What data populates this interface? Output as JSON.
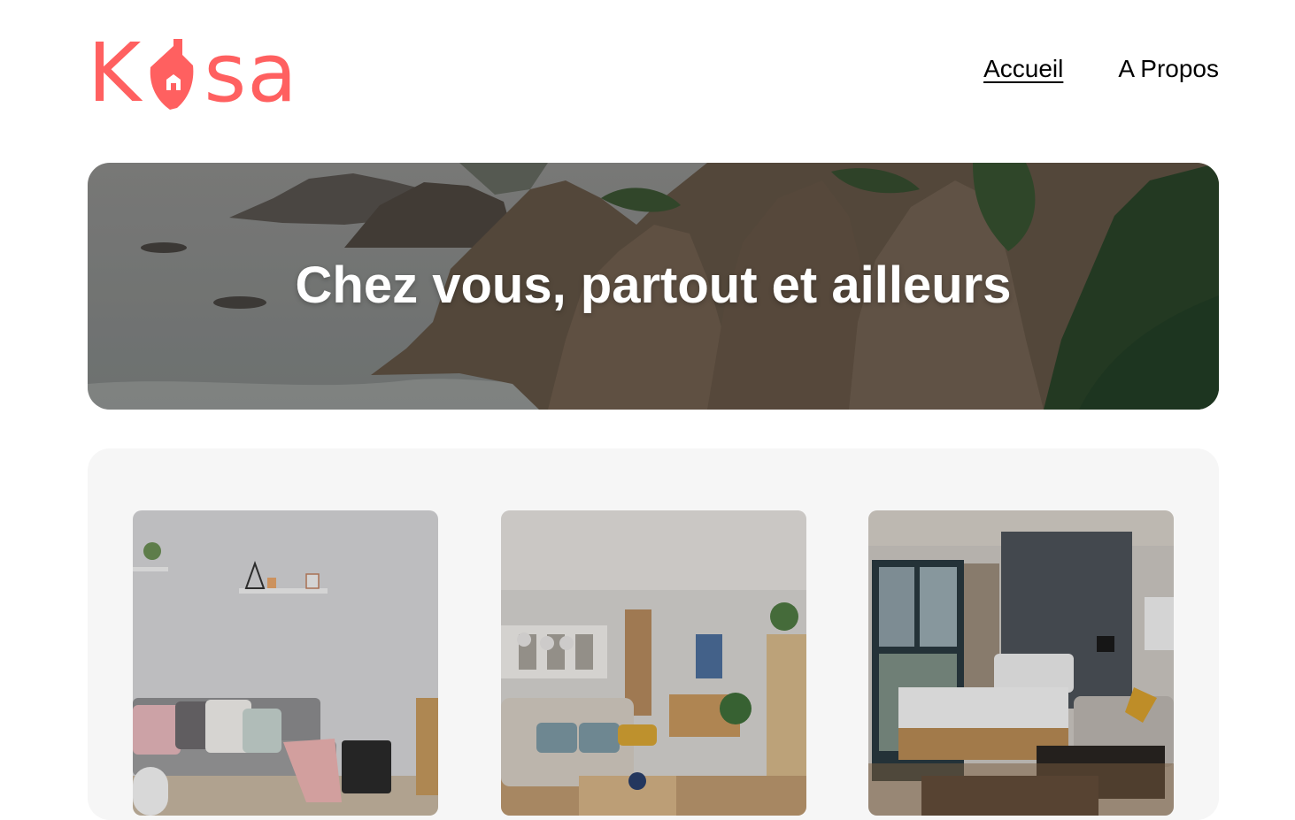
{
  "brand": {
    "logo_text_left": "K",
    "logo_text_right": "sa",
    "accent_color": "#FF6060",
    "logo_icon": "house-icon"
  },
  "nav": {
    "items": [
      {
        "label": "Accueil",
        "active": true
      },
      {
        "label": "A Propos",
        "active": false
      }
    ]
  },
  "banner": {
    "title": "Chez vous, partout et ailleurs"
  },
  "gallery": {
    "background": "#F6F6F6",
    "cards": [
      {
        "image": "living-room-grey-sofa"
      },
      {
        "image": "open-living-room-beige-sofa"
      },
      {
        "image": "hotel-bedroom"
      }
    ]
  }
}
